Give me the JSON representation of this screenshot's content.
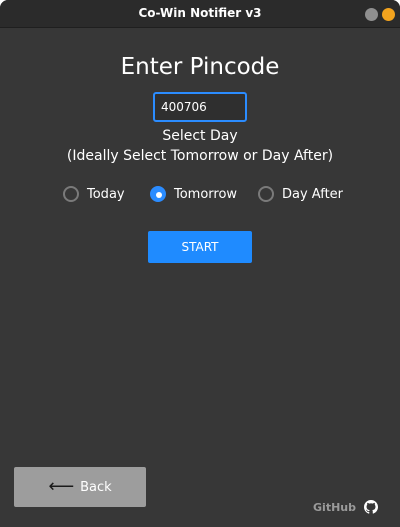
{
  "window": {
    "title": "Co-Win Notifier v3"
  },
  "main": {
    "heading": "Enter Pincode",
    "pincode_value": "400706",
    "select_day_label": "Select Day",
    "select_day_hint": "(Ideally Select Tomorrow or Day After)",
    "radio_options": [
      {
        "label": "Today",
        "checked": false
      },
      {
        "label": "Tomorrow",
        "checked": true
      },
      {
        "label": "Day After",
        "checked": false
      }
    ],
    "start_label": "START"
  },
  "footer": {
    "back_label": "Back",
    "github_label": "GitHub",
    "github_icon": "github-icon"
  },
  "colors": {
    "background": "#373737",
    "titlebar": "#2b2b2b",
    "accent": "#1f8bff",
    "back_button": "#9d9d9d",
    "window_close": "#f2a31e",
    "window_minimize": "#8f8f8f"
  }
}
